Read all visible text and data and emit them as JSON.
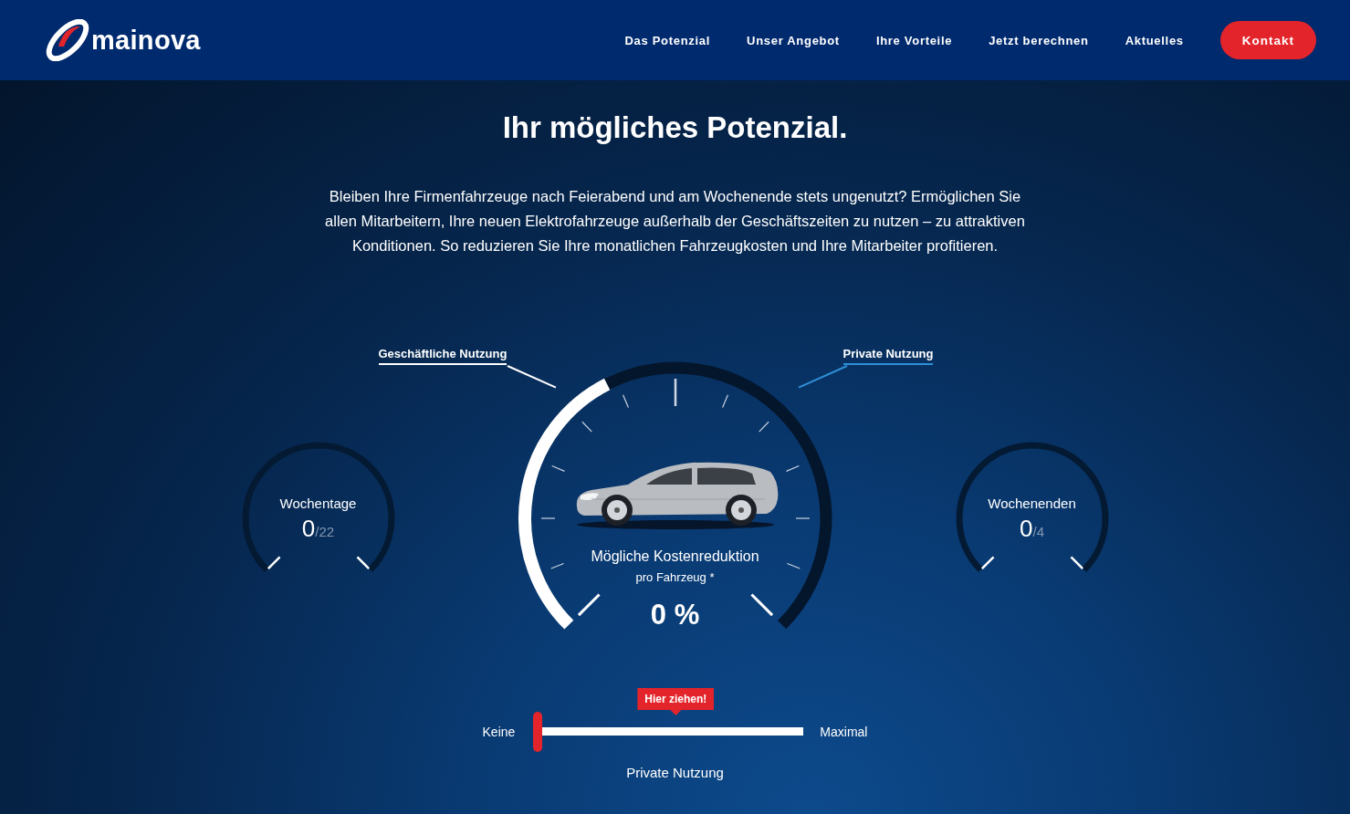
{
  "header": {
    "logo_text": "mainova",
    "nav": [
      {
        "label": "Das Potenzial"
      },
      {
        "label": "Unser Angebot"
      },
      {
        "label": "Ihre Vorteile"
      },
      {
        "label": "Jetzt berechnen"
      },
      {
        "label": "Aktuelles"
      }
    ],
    "contact_button": "Kontakt"
  },
  "hero": {
    "title": "Ihr mögliches Potenzial.",
    "text": "Bleiben Ihre Firmenfahrzeuge nach Feierabend und am Wochenende stets ungenutzt? Ermöglichen Sie allen Mitarbeitern, Ihre neuen Elektrofahrzeuge außerhalb der Geschäftszeiten zu nutzen – zu attraktiven Konditionen. So reduzieren Sie Ihre monatlichen Fahrzeugkosten und Ihre Mitarbeiter profitieren."
  },
  "side_gauges": [
    {
      "label": "Wochentage",
      "value": "0",
      "total": "/22"
    },
    {
      "label": "Wochenenden",
      "value": "0",
      "total": "/4"
    }
  ],
  "main_gauge": {
    "business_label": "Geschäftliche Nutzung",
    "private_label": "Private Nutzung",
    "caption": "Mögliche Kostenreduktion",
    "subcaption": "pro Fahrzeug *",
    "value": "0 %"
  },
  "slider": {
    "min_label": "Keine",
    "max_label": "Maximal",
    "hint": "Hier ziehen!",
    "label": "Private Nutzung",
    "level": 0
  }
}
